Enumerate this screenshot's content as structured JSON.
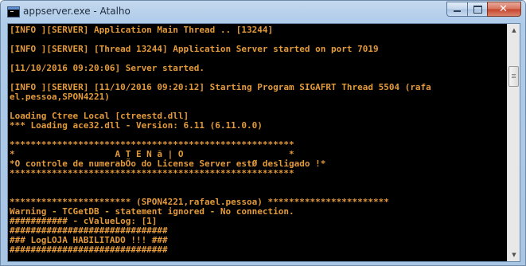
{
  "window": {
    "title": "appserver.exe - Atalho",
    "close_glyph": "✕"
  },
  "icons": {
    "app": "console-window-icon",
    "minimize": "minimize-icon",
    "maximize": "maximize-icon",
    "close": "close-icon",
    "scroll_up": "chevron-up-icon",
    "scroll_down": "chevron-down-icon"
  },
  "console": {
    "text_color": "#e39a3a",
    "background": "#000000",
    "lines": [
      "[INFO ][SERVER] Application Main Thread .. [13244]",
      "",
      "[INFO ][SERVER] [Thread 13244] Application Server started on port 7019",
      "",
      "[11/10/2016 09:20:06] Server started.",
      "",
      "[INFO ][SERVER] [11/10/2016 09:20:12] Starting Program SIGAFRT Thread 5504 (rafa",
      "el.pessoa,SPON4221)",
      "",
      "Loading Ctree Local [ctreestd.dll]",
      "*** Loading ace32.dll - Version: 6.11 (6.11.0.0)",
      "",
      "******************************************************",
      "*                   A T E N ã | O                    *",
      "*O controle de numerabÕo do License Server estØ desligado !*",
      "******************************************************",
      "",
      "",
      "*********************** (SPON4221,rafael.pessoa) ***********************",
      "Warning - TCGetDB - statement ignored - No connection.",
      "########### - cValueLog: [1]",
      "##############################",
      "### LogLOJA HABILITADO !!! ###",
      "##############################",
      ""
    ]
  },
  "scrollbar": {
    "up_glyph": "▲",
    "down_glyph": "▼"
  }
}
